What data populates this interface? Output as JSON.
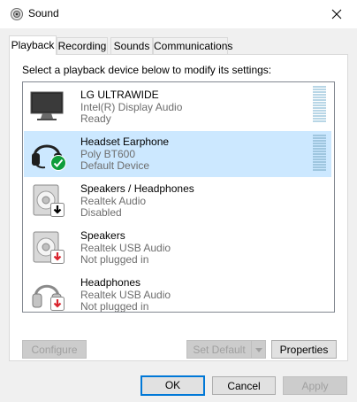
{
  "window": {
    "title": "Sound"
  },
  "tabs": [
    {
      "label": "Playback"
    },
    {
      "label": "Recording"
    },
    {
      "label": "Sounds"
    },
    {
      "label": "Communications"
    }
  ],
  "instruction": "Select a playback device below to modify its settings:",
  "devices": [
    {
      "name": "LG ULTRAWIDE",
      "driver": "Intel(R) Display Audio",
      "status": "Ready",
      "icon": "monitor-icon",
      "selected": false
    },
    {
      "name": "Headset Earphone",
      "driver": "Poly BT600",
      "status": "Default Device",
      "icon": "headset-icon",
      "badge": "green-check",
      "selected": true
    },
    {
      "name": "Speakers / Headphones",
      "driver": "Realtek Audio",
      "status": "Disabled",
      "icon": "speaker-icon",
      "badge": "black-down-arrow",
      "selected": false
    },
    {
      "name": "Speakers",
      "driver": "Realtek USB Audio",
      "status": "Not plugged in",
      "icon": "speaker-icon",
      "badge": "red-down-arrow",
      "selected": false
    },
    {
      "name": "Headphones",
      "driver": "Realtek USB Audio",
      "status": "Not plugged in",
      "icon": "headphones-icon",
      "badge": "red-down-arrow",
      "selected": false
    }
  ],
  "buttons": {
    "configure": "Configure",
    "set_default": "Set Default",
    "properties": "Properties",
    "ok": "OK",
    "cancel": "Cancel",
    "apply": "Apply"
  },
  "colors": {
    "selection": "#cce8ff",
    "default_button_border": "#0078d7",
    "check_badge": "#0f9d3a",
    "arrow_badge_red": "#d9232d"
  }
}
